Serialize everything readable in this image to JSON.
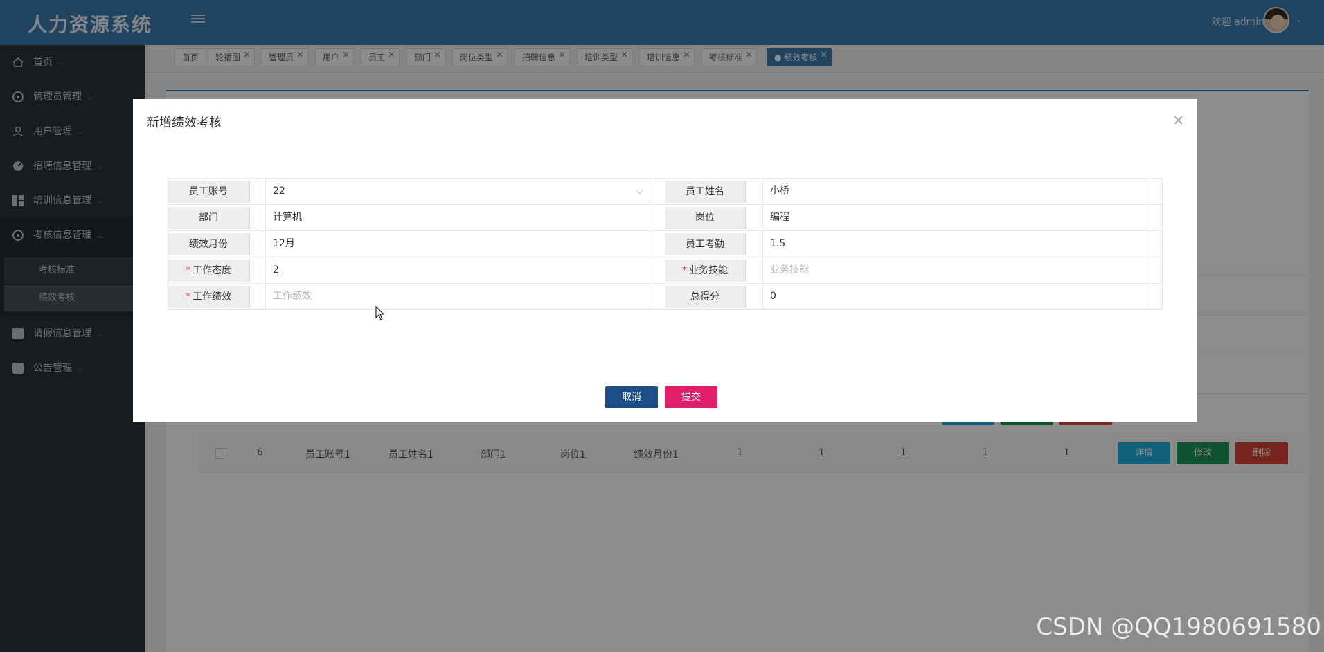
{
  "header": {
    "logo": "人力资源系统",
    "welcome": "欢迎 admin"
  },
  "sidebar": {
    "items": [
      {
        "label": "首页",
        "icon": "home-icon"
      },
      {
        "label": "管理员管理",
        "icon": "circle-icon"
      },
      {
        "label": "用户管理",
        "icon": "user-icon"
      },
      {
        "label": "招聘信息管理",
        "icon": "gauge-icon"
      },
      {
        "label": "培训信息管理",
        "icon": "grid-icon"
      },
      {
        "label": "考核信息管理",
        "icon": "circle-icon",
        "expanded": true,
        "children": [
          {
            "label": "考核标准"
          },
          {
            "label": "绩效考核",
            "active": true
          }
        ]
      },
      {
        "label": "请假信息管理",
        "icon": "book-icon"
      },
      {
        "label": "公告管理",
        "icon": "book-icon"
      }
    ]
  },
  "tabs": [
    {
      "label": "首页"
    },
    {
      "label": "轮播图"
    },
    {
      "label": "管理员"
    },
    {
      "label": "用户"
    },
    {
      "label": "员工"
    },
    {
      "label": "部门"
    },
    {
      "label": "岗位类型"
    },
    {
      "label": "招聘信息"
    },
    {
      "label": "培训类型"
    },
    {
      "label": "培训信息"
    },
    {
      "label": "考核标准"
    },
    {
      "label": "● 绩效考核",
      "active": true
    }
  ],
  "background_table": {
    "header_partial": "E",
    "last_row": {
      "id": "6",
      "account": "员工账号1",
      "name": "员工姓名1",
      "dept": "部门1",
      "post": "岗位1",
      "month": "绩效月份1",
      "v1": "1",
      "v2": "1",
      "v3": "1",
      "v4": "1",
      "v5": "1"
    },
    "buttons": {
      "detail": "详情",
      "edit": "修改",
      "delete": "删除"
    }
  },
  "modal": {
    "title": "新增绩效考核",
    "close": "×",
    "fields": {
      "account_label": "员工账号",
      "account_value": "22",
      "name_label": "员工姓名",
      "name_value": "小桥",
      "dept_label": "部门",
      "dept_value": "计算机",
      "post_label": "岗位",
      "post_value": "编程",
      "month_label": "绩效月份",
      "month_value": "12月",
      "attendance_label": "员工考勤",
      "attendance_value": "1.5",
      "attitude_label": "工作态度",
      "attitude_value": "2",
      "skill_label": "业务技能",
      "skill_placeholder": "业务技能",
      "performance_label": "工作绩效",
      "performance_placeholder": "工作绩效",
      "total_label": "总得分",
      "total_value": "0",
      "required_mark": "*"
    },
    "cancel": "取消",
    "submit": "提交"
  },
  "watermark": "CSDN @QQ1980691580"
}
